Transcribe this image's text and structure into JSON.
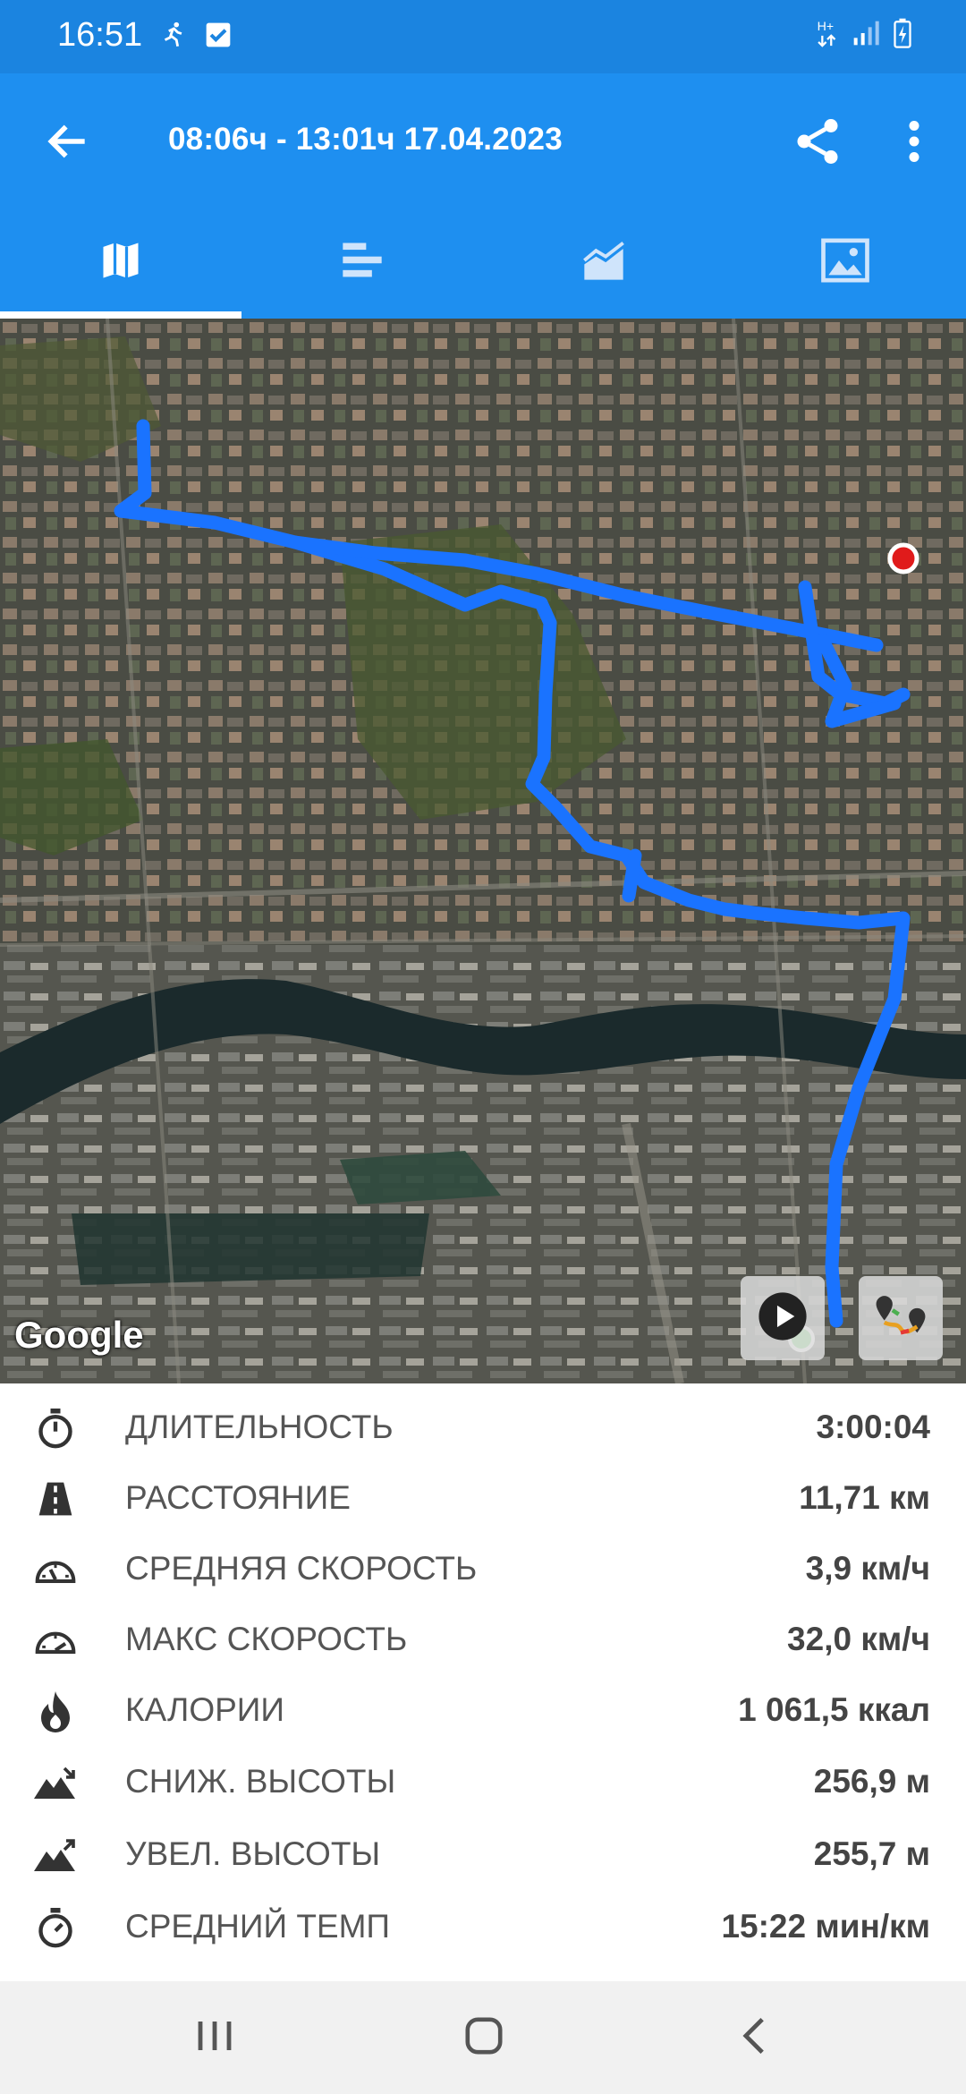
{
  "status_bar": {
    "time": "16:51"
  },
  "header": {
    "title": "08:06ч - 13:01ч   17.04.2023"
  },
  "tabs": [
    {
      "icon": "map-icon",
      "active": true
    },
    {
      "icon": "bars-icon",
      "active": false
    },
    {
      "icon": "chart-icon",
      "active": false
    },
    {
      "icon": "image-icon",
      "active": false
    }
  ],
  "map": {
    "attribution": "Google",
    "route_color": "#1a73ff"
  },
  "stats": [
    {
      "icon": "stopwatch-icon",
      "label": "ДЛИТЕЛЬНОСТЬ",
      "value": "3:00:04"
    },
    {
      "icon": "road-icon",
      "label": "РАССТОЯНИЕ",
      "value": "11,71 км"
    },
    {
      "icon": "speedometer-icon",
      "label": "СРЕДНЯЯ СКОРОСТЬ",
      "value": "3,9 км/ч"
    },
    {
      "icon": "speedometer-max-icon",
      "label": "МАКС СКОРОСТЬ",
      "value": "32,0 км/ч"
    },
    {
      "icon": "flame-icon",
      "label": "КАЛОРИИ",
      "value": "1 061,5 ккал"
    },
    {
      "icon": "mountain-down-icon",
      "label": "СНИЖ. ВЫСОТЫ",
      "value": "256,9 м"
    },
    {
      "icon": "mountain-up-icon",
      "label": "УВЕЛ. ВЫСОТЫ",
      "value": "255,7 м"
    },
    {
      "icon": "timer-icon",
      "label": "СРЕДНИЙ ТЕМП",
      "value": "15:22 мин/км"
    }
  ],
  "colors": {
    "accent": "#1e8ff0",
    "status_bar": "#1b84e0"
  }
}
